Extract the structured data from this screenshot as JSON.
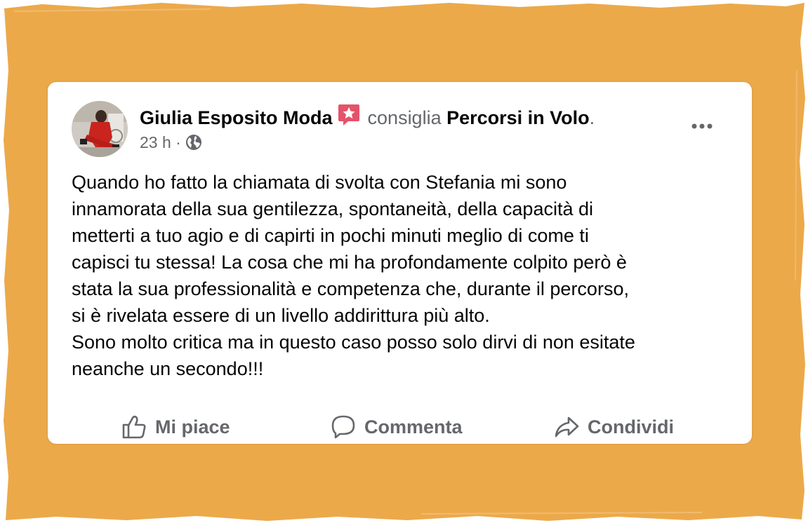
{
  "post": {
    "author_name": "Giulia Esposito Moda",
    "verb": "consiglia",
    "page_name": "Percorsi in Volo",
    "punctuation": ".",
    "time": "23 h",
    "separator": "·",
    "visibility_icon": "globe-icon",
    "recommend_badge_icon": "recommend-star-icon",
    "more_icon": "more-options-icon",
    "body": "Quando ho fatto la chiamata di svolta con Stefania mi sono\ninnamorata della sua gentilezza, spontaneità, della capacità di\nmetterti a tuo agio e di capirti in pochi minuti meglio di come ti\ncapisci tu stessa! La cosa che mi ha profondamente colpito però è\nstata la sua professionalità e competenza che, durante il percorso,\nsi è rivelata essere di un livello addirittura più alto.\nSono molto critica ma in questo caso posso solo dirvi di non esitate\nneanche un secondo!!!"
  },
  "actions": {
    "like_label": "Mi piace",
    "comment_label": "Commenta",
    "share_label": "Condividi",
    "like_icon": "thumbs-up-icon",
    "comment_icon": "comment-bubble-icon",
    "share_icon": "share-arrow-icon"
  },
  "colors": {
    "frame_background": "#ECA94A",
    "card_background": "#FFFFFF",
    "primary_text": "#050505",
    "secondary_text": "#65676B",
    "recommend_badge": "#E4536A"
  }
}
